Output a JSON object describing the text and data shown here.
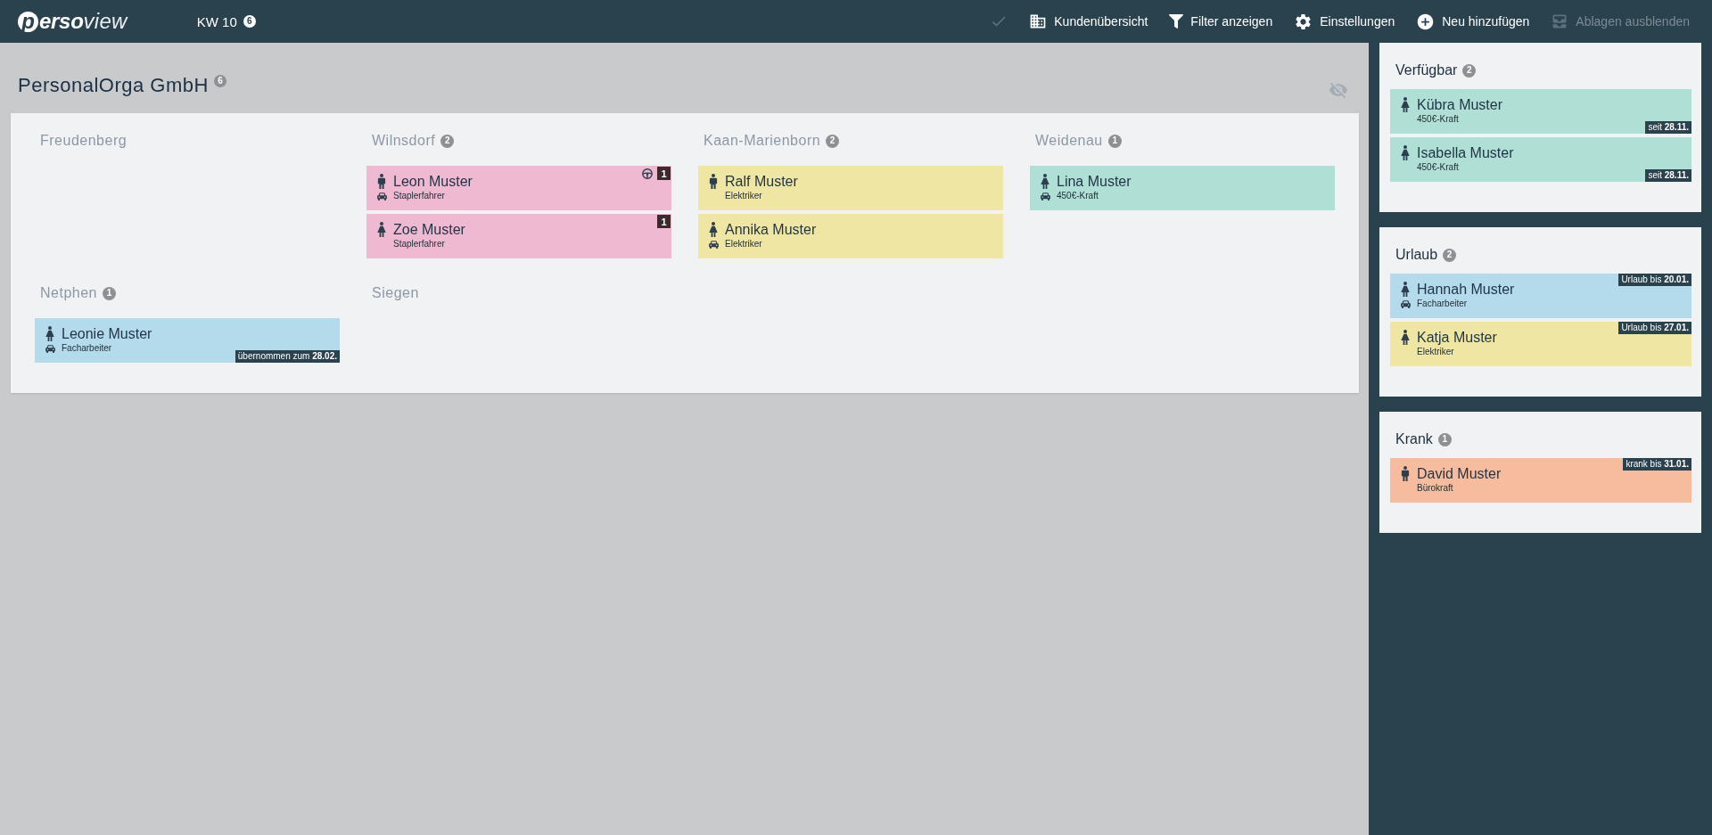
{
  "topbar": {
    "logo": {
      "bold_part": "perso",
      "light_part": "view"
    },
    "week": {
      "label": "KW 10",
      "count": "6"
    },
    "actions": [
      {
        "disabled": true
      },
      {
        "label": "Kundenübersicht",
        "disabled": false
      },
      {
        "label": "Filter anzeigen",
        "disabled": false
      },
      {
        "label": "Einstellungen",
        "disabled": false
      },
      {
        "label": "Neu hinzufügen",
        "disabled": false
      },
      {
        "label": "Ablagen ausblenden",
        "disabled": true
      }
    ]
  },
  "company": {
    "name": "PersonalOrga GmbH",
    "count": "6"
  },
  "locations": [
    {
      "name": "Freudenberg"
    },
    {
      "name": "Wilnsdorf",
      "count": "2",
      "people": [
        {
          "kind": "male",
          "name": "Leon Muster",
          "role": "Staplerfahrer",
          "car": true,
          "wheel": true,
          "count": "1",
          "color": "#efbad1"
        },
        {
          "kind": "female",
          "name": "Zoe Muster",
          "role": "Staplerfahrer",
          "car": false,
          "wheel": false,
          "count": "1",
          "color": "#efbad1"
        }
      ]
    },
    {
      "name": "Kaan-Marienborn",
      "count": "2",
      "people": [
        {
          "kind": "male",
          "name": "Ralf Muster",
          "role": "Elektriker",
          "car": false,
          "wheel": false,
          "color": "#f0e6a4"
        },
        {
          "kind": "female",
          "name": "Annika Muster",
          "role": "Elektriker",
          "car": true,
          "wheel": false,
          "color": "#f0e6a4"
        }
      ]
    },
    {
      "name": "Weidenau",
      "count": "1",
      "people": [
        {
          "kind": "female",
          "name": "Lina Muster",
          "role": "450€-Kraft",
          "car": true,
          "wheel": false,
          "color": "#b0dfd5"
        }
      ]
    },
    {
      "name": "Netphen",
      "count": "1",
      "people": [
        {
          "kind": "female",
          "name": "Leonie Muster",
          "role": "Facharbeiter",
          "car": true,
          "wheel": false,
          "color": "#b3dbeb",
          "tag": {
            "text": "übernommen zum **28.02.**",
            "at_top": false
          }
        }
      ]
    },
    {
      "name": "Siegen"
    }
  ],
  "sidebar": {
    "panels": [
      {
        "title": "Verfügbar",
        "count": "2",
        "people": [
          {
            "kind": "female",
            "name": "Kübra Muster",
            "role": "450€-Kraft",
            "car": false,
            "wheel": false,
            "color": "#b0dfd5",
            "tag": {
              "text": "seit **28.11.**",
              "at_top": false
            }
          },
          {
            "kind": "female",
            "name": "Isabella Muster",
            "role": "450€-Kraft",
            "car": false,
            "wheel": false,
            "color": "#b0dfd5",
            "tag": {
              "text": "seit **28.11.**",
              "at_top": false
            }
          }
        ]
      },
      {
        "title": "Urlaub",
        "count": "2",
        "people": [
          {
            "kind": "female",
            "name": "Hannah Muster",
            "role": "Facharbeiter",
            "car": true,
            "wheel": false,
            "color": "#b3dbeb",
            "tag": {
              "text": "Urlaub bis **20.01.**",
              "at_top": true
            }
          },
          {
            "kind": "female",
            "name": "Katja Muster",
            "role": "Elektriker",
            "car": false,
            "wheel": false,
            "color": "#f0e6a4",
            "tag": {
              "text": "Urlaub bis **27.01.**",
              "at_top": true
            }
          }
        ]
      },
      {
        "title": "Krank",
        "count": "1",
        "people": [
          {
            "kind": "male",
            "name": "David Muster",
            "role": "Bürokraft",
            "car": false,
            "wheel": false,
            "color": "#f7bc9d",
            "tag": {
              "text": "krank bis **31.01.**",
              "at_top": true
            }
          }
        ]
      }
    ]
  }
}
